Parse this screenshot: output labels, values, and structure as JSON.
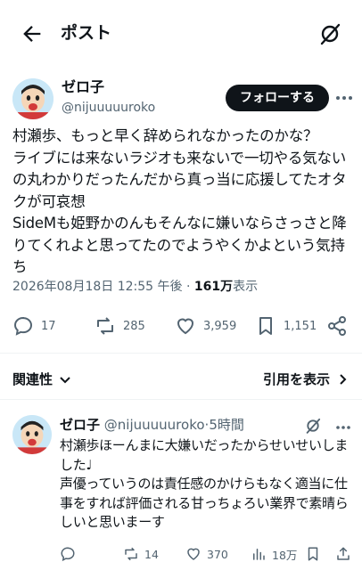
{
  "header": {
    "title": "ポスト",
    "back_icon": "arrow-left-icon",
    "grok_icon": "grok-icon"
  },
  "post": {
    "author_name": "ゼロ子",
    "author_handle": "@nijuuuuuroko",
    "follow_label": "フォローする",
    "text": "村瀬歩、もっと早く辞められなかったのかな？\nライブには来ないラジオも来ないで一切やる気ないの丸わかりだったんだから真っ当に応援してたオタクが可哀想\nSideMも姫野かのんもそんなに嫌いならさっさと降りてくれよと思ってたのでようやくかよという気持ち",
    "timestamp": "2026年08月18日 12:55 午後",
    "dot": "·",
    "views_count": "161万",
    "views_label": "表示",
    "stats": {
      "replies": "17",
      "reposts": "285",
      "likes": "3,959",
      "bookmarks": "1,151"
    }
  },
  "sort": {
    "label": "関連性",
    "quote_label": "引用を表示"
  },
  "reply": {
    "author_name": "ゼロ子",
    "author_handle": "@nijuuuuuroko",
    "dot": "·",
    "time": "5時間",
    "text": "村瀬歩ほーんまに大嫌いだったからせいせいしました♩\n声優っていうのは責任感のかけらもなく適当に仕事をすれば評価される甘っちょろい業界で素晴らしいと思いまーす",
    "stats": {
      "replies": "",
      "reposts": "14",
      "likes": "370",
      "views": "18万"
    }
  },
  "colors": {
    "text": "#0f1419",
    "secondary": "#536471",
    "divider": "#eff3f4",
    "avatar_bg": "#c9e7f7",
    "button_bg": "#0f1419"
  }
}
